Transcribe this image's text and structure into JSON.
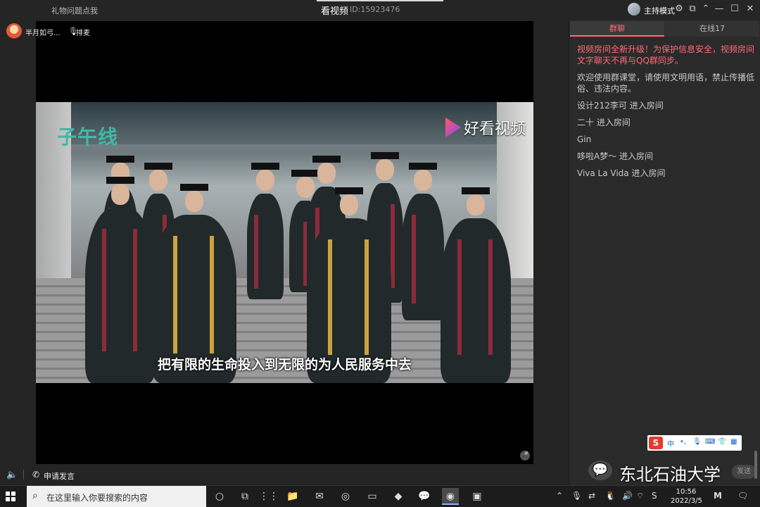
{
  "window": {
    "gift_notice": "礼物问题点我",
    "title": "看视频",
    "room_id": "ID:15923476",
    "host_mode": "主持模式"
  },
  "room": {
    "user_name": "半月如弓...",
    "queue_label": "排麦",
    "apply_speak": "申请发言"
  },
  "video": {
    "logo_left": "子午线",
    "logo_right": "好看视频",
    "subtitle": "把有限的生命投入到无限的为人民服务中去"
  },
  "panel": {
    "tabs": [
      {
        "label": "群聊",
        "active": true
      },
      {
        "label": "在线17",
        "active": false
      }
    ],
    "messages": [
      {
        "text": "视频房间全新升级！为保护信息安全，视频房间文字聊天不再与QQ群同步。",
        "type": "notice"
      },
      {
        "text": "欢迎使用群课堂，请使用文明用语，禁止传播低俗、违法内容。",
        "type": "info"
      },
      {
        "text": "设计212李可 进入房间",
        "type": "info"
      },
      {
        "text": "二十 进入房间",
        "type": "info"
      },
      {
        "text": "Gin",
        "type": "info"
      },
      {
        "text": "哆啦A梦～ 进入房间",
        "type": "info"
      },
      {
        "text": "Viva La Vida 进入房间",
        "type": "info"
      }
    ],
    "send_label": "发送"
  },
  "watermark": "东北石油大学",
  "taskbar": {
    "search_placeholder": "在这里输入你要搜索的内容",
    "time": "10:56",
    "date": "2022/3/5"
  },
  "colors": {
    "accent": "#ff6b7a",
    "panel_bg": "#2a2a2a",
    "app_bg": "#242424"
  }
}
